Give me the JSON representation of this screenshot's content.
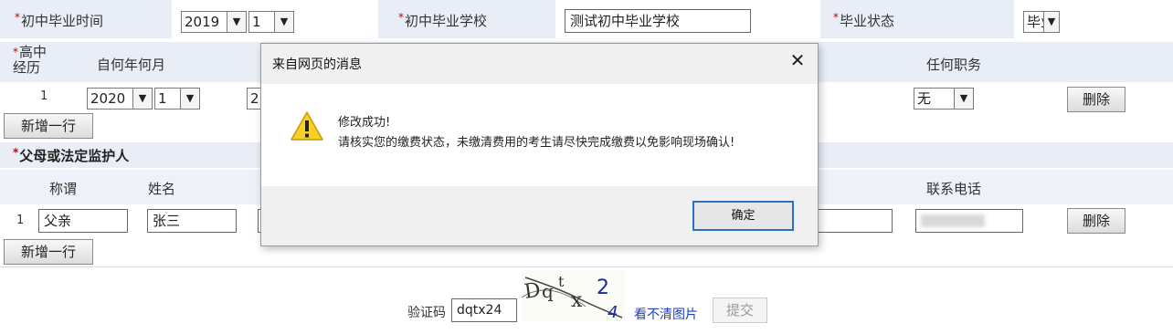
{
  "junior": {
    "grad_time_label": "初中毕业时间",
    "grad_year": "2019",
    "grad_month": "1",
    "school_label": "初中毕业学校",
    "school_value": "测试初中毕业学校",
    "status_label": "毕业状态",
    "status_value": "毕业"
  },
  "high_school": {
    "label": "高中经历",
    "col_from": "自何年何月",
    "col_position": "任何职务",
    "row_index": "1",
    "from_year": "2020",
    "from_month": "1",
    "to_year_partial": "2",
    "position_value": "无",
    "delete_label": "删除",
    "add_label": "新增一行"
  },
  "guardian": {
    "section_label": "父母或法定监护人",
    "col_relation": "称谓",
    "col_name": "姓名",
    "col_phone": "联系电话",
    "row_index": "1",
    "relation_value": "父亲",
    "name_value": "张三",
    "delete_label": "删除",
    "add_label": "新增一行"
  },
  "captcha": {
    "label": "验证码",
    "value": "dqtx24",
    "image_text": "Dqtx24",
    "refresh_link": "看不清图片",
    "submit_label": "提交"
  },
  "dialog": {
    "title": "来自网页的消息",
    "line1": "修改成功!",
    "line2": "请核实您的缴费状态，未缴清费用的考生请尽快完成缴费以免影响现场确认!",
    "ok_label": "确定",
    "icon": "warning-icon",
    "close_icon": "close-icon"
  },
  "colors": {
    "label_bg": "#e9edf5",
    "required_star": "#d40000",
    "dialog_bg": "#f0f0f0",
    "ok_border": "#2b6fc7",
    "link": "#1f3fbf"
  }
}
